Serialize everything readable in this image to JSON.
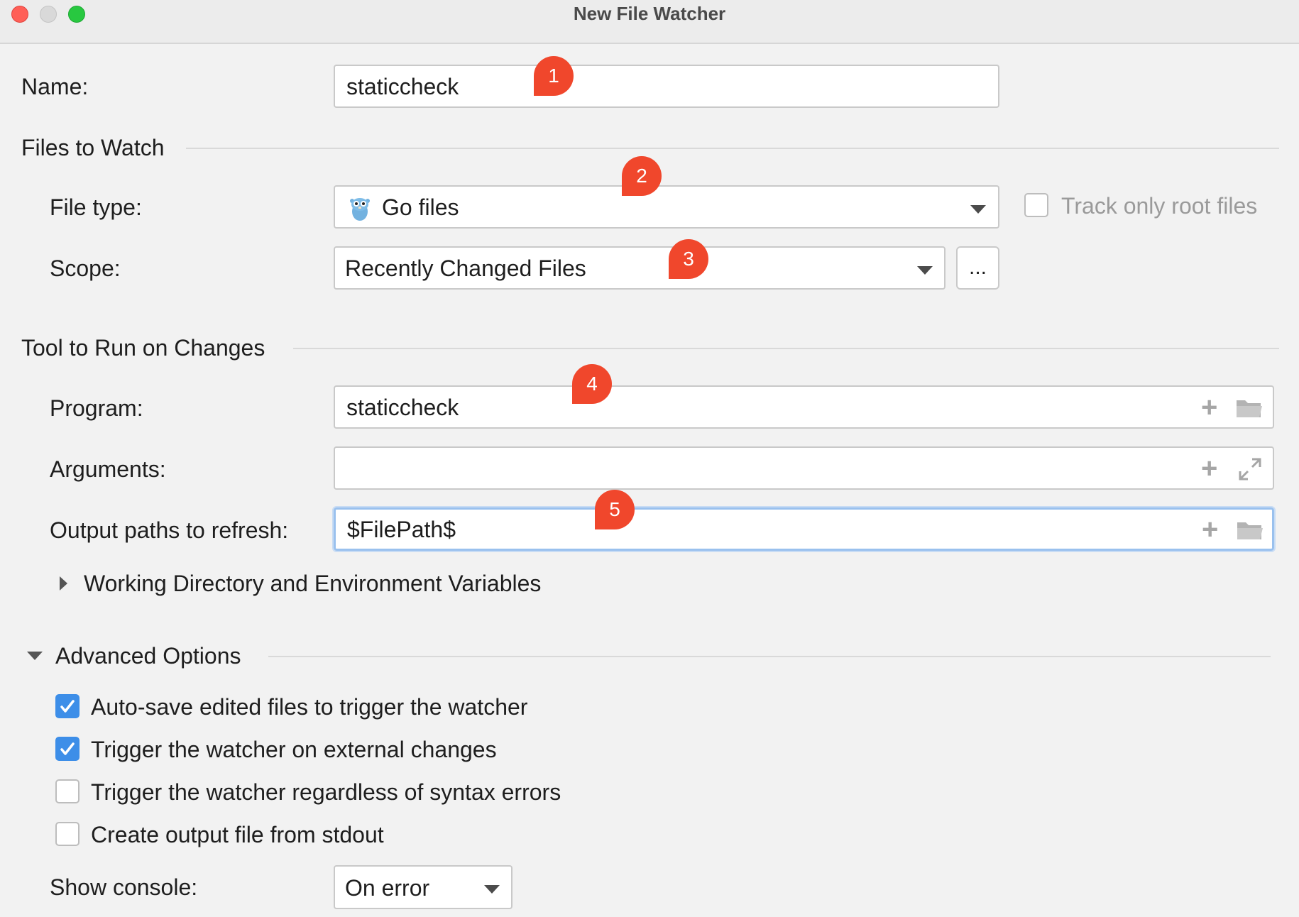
{
  "window": {
    "title": "New File Watcher"
  },
  "name": {
    "label": "Name:",
    "value": "staticcheck"
  },
  "files_to_watch": {
    "section_title": "Files to Watch",
    "file_type_label": "File type:",
    "file_type_value": "Go files",
    "track_only_root_label": "Track only root files",
    "track_only_root_checked": false,
    "scope_label": "Scope:",
    "scope_value": "Recently Changed Files",
    "scope_more_label": "..."
  },
  "tool": {
    "section_title": "Tool to Run on Changes",
    "program_label": "Program:",
    "program_value": "staticcheck",
    "arguments_label": "Arguments:",
    "arguments_value": "",
    "output_label": "Output paths to refresh:",
    "output_value": "$FilePath$",
    "working_dir_label": "Working Directory and Environment Variables"
  },
  "advanced": {
    "section_title": "Advanced Options",
    "options": [
      {
        "label": "Auto-save edited files to trigger the watcher",
        "checked": true
      },
      {
        "label": "Trigger the watcher on external changes",
        "checked": true
      },
      {
        "label": "Trigger the watcher regardless of syntax errors",
        "checked": false
      },
      {
        "label": "Create output file from stdout",
        "checked": false
      }
    ],
    "show_console_label": "Show console:",
    "show_console_value": "On error"
  },
  "callouts": [
    "1",
    "2",
    "3",
    "4",
    "5"
  ],
  "colors": {
    "callout": "#f0472c",
    "checkbox_checked": "#3d8ee8",
    "focus_border": "#9ac1ee"
  }
}
